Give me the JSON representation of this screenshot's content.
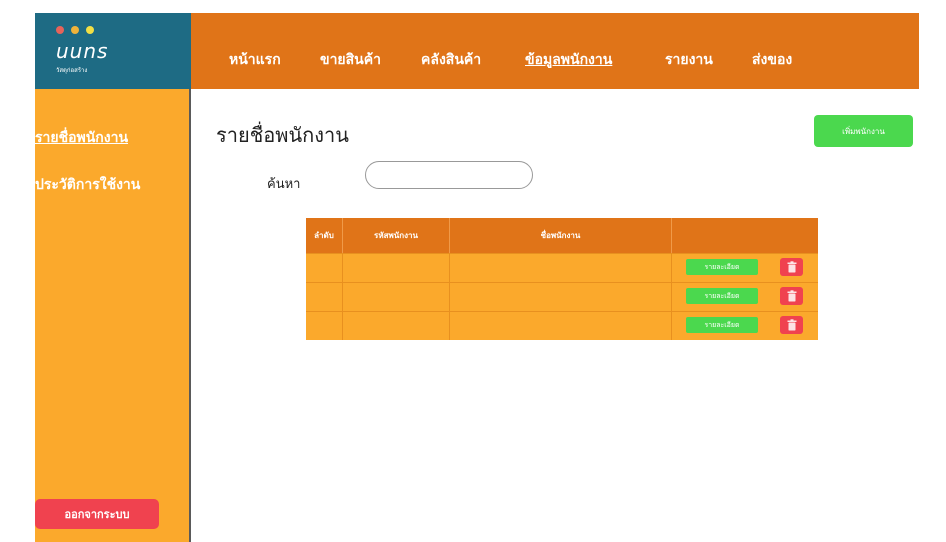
{
  "logo": {
    "title": "uuns",
    "subtitle": "วัสดุก่อสร้าง"
  },
  "colors": {
    "dot1": "#e8635a",
    "dot2": "#f0b33a",
    "dot3": "#f2df45",
    "header": "#e07418",
    "sidebar": "#fba92c",
    "logo_bg": "#1e6b84"
  },
  "nav": [
    "หน้าแรก",
    "ขายสินค้า",
    "คลังสินค้า",
    "ข้อมูลพนักงาน",
    "รายงาน",
    "ส่งของ"
  ],
  "sidebar": {
    "items": [
      "รายชื่อพนักงาน",
      "ประวัติการใช้งาน"
    ],
    "logout": "ออกจากระบบ"
  },
  "main": {
    "title": "รายชื่อพนักงาน",
    "add_button": "เพิ่มพนักงาน",
    "search_label": "ค้นหา",
    "search_value": ""
  },
  "table": {
    "headers": [
      "ลำดับ",
      "รหัสพนักงาน",
      "ชื่อพนักงาน",
      ""
    ],
    "rows": [
      {
        "order": "",
        "code": "",
        "name": "",
        "detail": "รายละเอียด",
        "delete_icon": "trash-icon"
      },
      {
        "order": "",
        "code": "",
        "name": "",
        "detail": "รายละเอียด",
        "delete_icon": "trash-icon"
      },
      {
        "order": "",
        "code": "",
        "name": "",
        "detail": "รายละเอียด",
        "delete_icon": "trash-icon"
      }
    ]
  }
}
